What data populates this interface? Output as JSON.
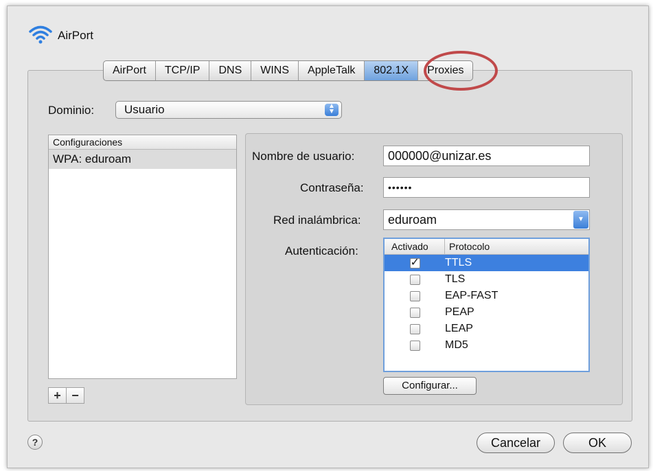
{
  "window": {
    "title": "AirPort"
  },
  "tabs": [
    {
      "label": "AirPort",
      "active": false
    },
    {
      "label": "TCP/IP",
      "active": false
    },
    {
      "label": "DNS",
      "active": false
    },
    {
      "label": "WINS",
      "active": false
    },
    {
      "label": "AppleTalk",
      "active": false
    },
    {
      "label": "802.1X",
      "active": true
    },
    {
      "label": "Proxies",
      "active": false
    }
  ],
  "domain": {
    "label": "Dominio:",
    "value": "Usuario"
  },
  "configurations": {
    "header": "Configuraciones",
    "items": [
      "WPA: eduroam"
    ]
  },
  "form": {
    "username_label": "Nombre de usuario:",
    "username_value": "000000@unizar.es",
    "password_label": "Contraseña:",
    "password_value": "••••••",
    "network_label": "Red inalámbrica:",
    "network_value": "eduroam",
    "auth_label": "Autenticación:",
    "auth_columns": {
      "enabled": "Activado",
      "protocol": "Protocolo"
    },
    "protocols": [
      {
        "name": "TTLS",
        "checked": true,
        "selected": true
      },
      {
        "name": "TLS",
        "checked": false,
        "selected": false
      },
      {
        "name": "EAP-FAST",
        "checked": false,
        "selected": false
      },
      {
        "name": "PEAP",
        "checked": false,
        "selected": false
      },
      {
        "name": "LEAP",
        "checked": false,
        "selected": false
      },
      {
        "name": "MD5",
        "checked": false,
        "selected": false
      }
    ],
    "configure_button": "Configurar..."
  },
  "list_controls": {
    "add": "+",
    "remove": "−"
  },
  "footer": {
    "help": "?",
    "cancel": "Cancelar",
    "ok": "OK"
  },
  "colors": {
    "selection": "#3d80df",
    "annotation": "#c0494a",
    "active_tab": "#8fb9ea"
  }
}
